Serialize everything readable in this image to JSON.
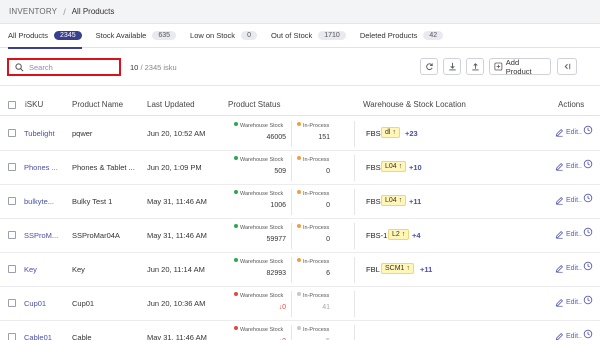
{
  "breadcrumb": {
    "root": "INVENTORY",
    "separator": "/",
    "current": "All Products"
  },
  "tabs": [
    {
      "label": "All Products",
      "count": "2345",
      "active": true
    },
    {
      "label": "Stock Available",
      "count": "635",
      "active": false
    },
    {
      "label": "Low on Stock",
      "count": "0",
      "active": false
    },
    {
      "label": "Out of Stock",
      "count": "1710",
      "active": false
    },
    {
      "label": "Deleted Products",
      "count": "42",
      "active": false
    }
  ],
  "search": {
    "placeholder": "Search",
    "value": ""
  },
  "result_count": {
    "shown": "10",
    "total": "/ 2345 isku"
  },
  "toolbar": {
    "add_product_label": "Add Product"
  },
  "columns": {
    "isku": "iSKU",
    "product_name": "Product Name",
    "last_updated": "Last Updated",
    "product_status": "Product Status",
    "warehouse": "Warehouse & Stock Location",
    "actions": "Actions"
  },
  "status_labels": {
    "warehouse_stock": "Warehouse Stock",
    "in_process": "In-Process"
  },
  "action_labels": {
    "edit": "Edit.."
  },
  "colors": {
    "accent": "#3a3f8f",
    "highlight_border": "#e0101a",
    "green_dot": "#2fa84f",
    "orange_dot": "#f0a040",
    "red_dot": "#e04a3f",
    "chip_bg": "#fff6b8"
  },
  "rows": [
    {
      "sku": "Tubelight",
      "name": "pqwer",
      "updated": "Jun 20, 10:52 AM",
      "ws_stock": "46005",
      "ws_dot": "green",
      "ws_red": false,
      "ip": "151",
      "ip_dot": "orange",
      "ip_grey": false,
      "wh": "FBS",
      "loc": "dl ↑",
      "more": "+23"
    },
    {
      "sku": "Phones ...",
      "name": "Phones & Tablet ...",
      "updated": "Jun 20, 1:09 PM",
      "ws_stock": "509",
      "ws_dot": "green",
      "ws_red": false,
      "ip": "0",
      "ip_dot": "orange",
      "ip_grey": false,
      "wh": "FBS",
      "loc": "L04 ↑",
      "more": "+10"
    },
    {
      "sku": "bulkyte...",
      "name": "Bulky Test 1",
      "updated": "May 31, 11:46 AM",
      "ws_stock": "1006",
      "ws_dot": "green",
      "ws_red": false,
      "ip": "0",
      "ip_dot": "orange",
      "ip_grey": false,
      "wh": "FBS",
      "loc": "L04 ↑",
      "more": "+11"
    },
    {
      "sku": "SSProM...",
      "name": "SSProMar04A",
      "updated": "May 31, 11:46 AM",
      "ws_stock": "59977",
      "ws_dot": "green",
      "ws_red": false,
      "ip": "0",
      "ip_dot": "orange",
      "ip_grey": false,
      "wh": "FBS-1",
      "loc": "L2 ↑",
      "more": "+4"
    },
    {
      "sku": "Key",
      "name": "Key",
      "updated": "Jun 20, 11:14 AM",
      "ws_stock": "82993",
      "ws_dot": "green",
      "ws_red": false,
      "ip": "6",
      "ip_dot": "orange",
      "ip_grey": false,
      "wh": "FBL",
      "loc": "SCM1 ↑",
      "more": "+11"
    },
    {
      "sku": "Cup01",
      "name": "Cup01",
      "updated": "Jun 20, 10:36 AM",
      "ws_stock": "↓0",
      "ws_dot": "red",
      "ws_red": true,
      "ip": "41",
      "ip_dot": "grey",
      "ip_grey": true,
      "wh": "",
      "loc": "",
      "more": ""
    },
    {
      "sku": "Cable01",
      "name": "Cable",
      "updated": "May 31, 11:46 AM",
      "ws_stock": "↓0",
      "ws_dot": "red",
      "ws_red": true,
      "ip": "5",
      "ip_dot": "grey",
      "ip_grey": true,
      "wh": "",
      "loc": "",
      "more": ""
    }
  ]
}
